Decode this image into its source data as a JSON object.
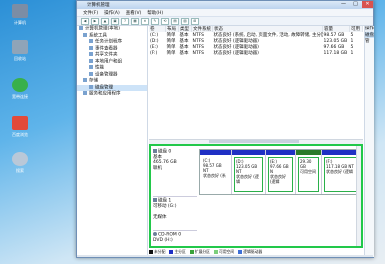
{
  "desktop": {
    "icons": [
      {
        "label": "计算机",
        "color": "#7b8da5"
      },
      {
        "label": "回收站",
        "color": "#8fa4b8"
      },
      {
        "label": "宽带连接",
        "color": "#38b04a"
      },
      {
        "label": "百度浏览",
        "color": "#e24a3a"
      },
      {
        "label": "搜索",
        "color": "#b9c8d8"
      }
    ]
  },
  "window": {
    "title": "计算机管理",
    "menu": [
      "文件(F)",
      "操作(A)",
      "查看(V)",
      "帮助(H)"
    ],
    "controls": {
      "min": "—",
      "max": "□",
      "close": "✕"
    }
  },
  "toolbar": {
    "buttons": [
      "◀",
      "▶",
      "▲",
      "▣",
      "?",
      "▦",
      "✕",
      "✎",
      "⟲",
      "▤",
      "▧",
      "⊞"
    ]
  },
  "tree": {
    "items": [
      {
        "label": "计算机管理(本地)",
        "indent": 0
      },
      {
        "label": "系统工具",
        "indent": 1
      },
      {
        "label": "任务计划程序",
        "indent": 2
      },
      {
        "label": "事件查看器",
        "indent": 2
      },
      {
        "label": "共享文件夹",
        "indent": 2
      },
      {
        "label": "本地用户和组",
        "indent": 2
      },
      {
        "label": "性能",
        "indent": 2
      },
      {
        "label": "设备管理器",
        "indent": 2
      },
      {
        "label": "存储",
        "indent": 1
      },
      {
        "label": "磁盘管理",
        "indent": 2,
        "selected": true
      },
      {
        "label": "服务和应用程序",
        "indent": 1
      }
    ]
  },
  "volumes": {
    "columns": [
      "卷",
      "布局",
      "类型",
      "文件系统",
      "状态",
      "容量",
      "可用"
    ],
    "rows": [
      [
        "(C:)",
        "简单",
        "基本",
        "NTFS",
        "状态良好 (系统, 启动, 页面文件, 活动, 故障转储, 主分区)",
        "98.57 GB",
        "5"
      ],
      [
        "(D:)",
        "简单",
        "基本",
        "NTFS",
        "状态良好 (逻辑驱动器)",
        "123.05 GB",
        "1"
      ],
      [
        "(E:)",
        "简单",
        "基本",
        "NTFS",
        "状态良好 (逻辑驱动器)",
        "97.66 GB",
        "5"
      ],
      [
        "(F:)",
        "简单",
        "基本",
        "NTFS",
        "状态良好 (逻辑驱动器)",
        "117.18 GB",
        "1"
      ]
    ]
  },
  "actions": {
    "header": "操作",
    "selected": "磁盘管"
  },
  "disks": [
    {
      "name": "磁盘 0",
      "type": "基本",
      "size": "465.76 GB",
      "status": "联机"
    },
    {
      "name": "磁盘 1",
      "type": "可移动 (G:)",
      "size": "",
      "status": "无媒体"
    },
    {
      "name": "CD-ROM 0",
      "type": "DVD (H:)",
      "size": "",
      "status": ""
    }
  ],
  "partitions": [
    {
      "label": "(C:)",
      "size": "98.57 GB NT",
      "status": "状态良好 (系",
      "bar": "blue"
    },
    {
      "label": "(D:)",
      "size": "123.05 GB NT",
      "status": "状态良好 (逻辑",
      "bar": "blue",
      "hl": true
    },
    {
      "label": "(E:)",
      "size": "97.66 GB N",
      "status": "状态良好 (逻辑",
      "bar": "blue",
      "hl": true
    },
    {
      "label": "",
      "size": "29.30 GB",
      "status": "可用空间",
      "bar": "green",
      "hl": true
    },
    {
      "label": "(F:)",
      "size": "117.18 GB NT",
      "status": "状态良好 (逻辑",
      "bar": "blue",
      "hl": true
    }
  ],
  "legend": [
    {
      "label": "未分配",
      "color": "#111111"
    },
    {
      "label": "主分区",
      "color": "#1f2fc4"
    },
    {
      "label": "扩展分区",
      "color": "#3aa23a"
    },
    {
      "label": "可用空间",
      "color": "#7ccf7c"
    },
    {
      "label": "逻辑驱动器",
      "color": "#3f70d6"
    }
  ]
}
